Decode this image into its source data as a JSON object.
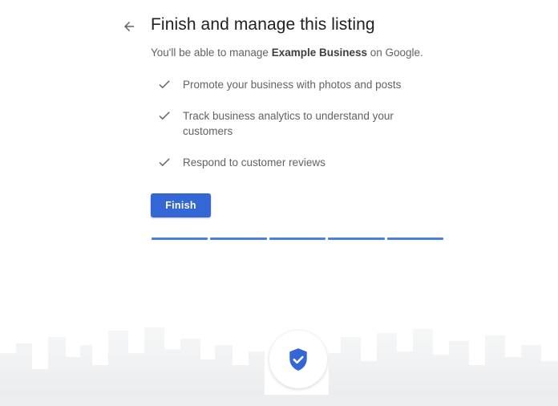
{
  "header": {
    "title": "Finish and manage this listing",
    "subtitle_prefix": "You'll be able to manage ",
    "business_name": "Example Business",
    "subtitle_suffix": " on Google."
  },
  "benefits": [
    {
      "icon": "check-icon",
      "text": "Promote your business with photos and posts"
    },
    {
      "icon": "check-icon",
      "text": "Track business analytics to understand your customers"
    },
    {
      "icon": "check-icon",
      "text": "Respond to customer reviews"
    }
  ],
  "actions": {
    "finish_label": "Finish"
  },
  "progress": {
    "completed_steps": 5,
    "total_steps": 5
  },
  "footer": {
    "badge_icon": "verified-shield-icon"
  },
  "colors": {
    "accent": "#3367d6",
    "progress": "#4a7fe0",
    "text_primary": "#202124",
    "text_secondary": "#5f6368"
  }
}
